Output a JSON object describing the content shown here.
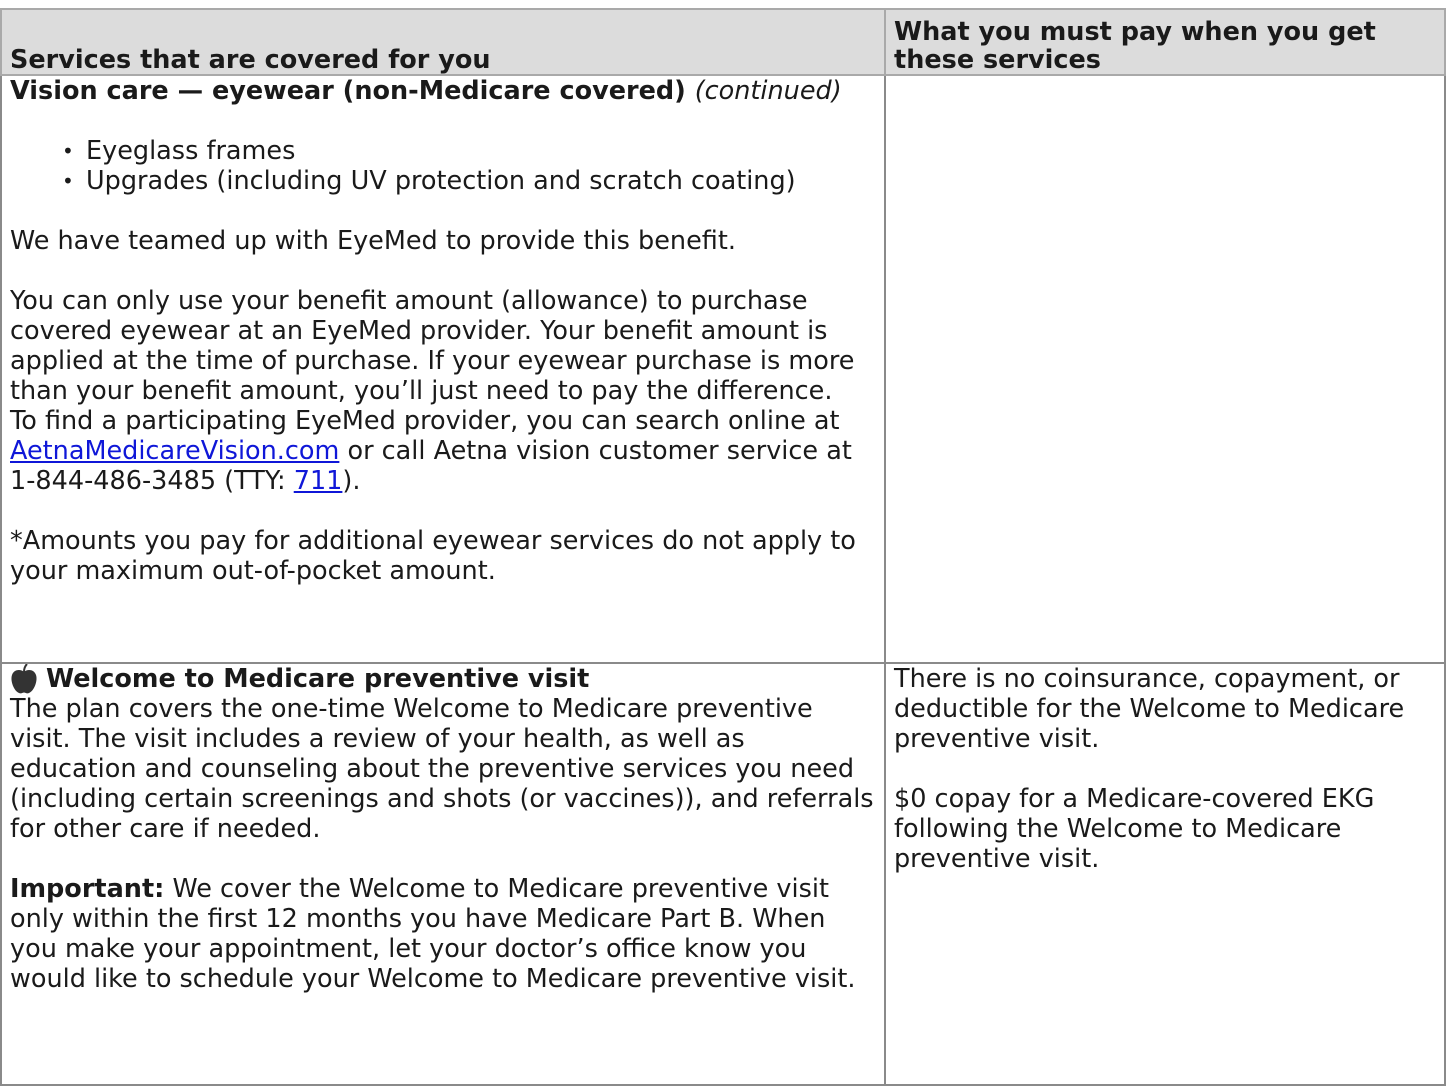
{
  "header": {
    "col1": "Services that are covered for you",
    "col2": "What you must pay when you get these services"
  },
  "vision": {
    "title": "Vision care — eyewear (non-Medicare covered)",
    "continued": "(continued)",
    "bullets": [
      "Eyeglass frames",
      "Upgrades (including UV protection and scratch coating)"
    ],
    "partner_text": "We have teamed up with EyeMed to provide this benefit.",
    "allowance_text": "You can only use your benefit amount (allowance) to purchase covered eyewear at an EyeMed provider. Your benefit amount is applied at the time of purchase. If your eyewear purchase is more than your benefit amount, you’ll just need to pay the difference.",
    "find_prefix": "To find a participating EyeMed provider, you can search online at",
    "find_link": "AetnaMedicareVision.com",
    "find_middle": "or call Aetna vision customer service at 1-844-486-3485 (TTY:",
    "tty_link": "711",
    "find_suffix": ").",
    "footnote": "*Amounts you pay for additional eyewear services do not apply to your maximum out-of-pocket amount."
  },
  "welcome": {
    "icon": "apple-icon",
    "title": "Welcome to Medicare preventive visit",
    "description": "The plan covers the one-time Welcome to Medicare preventive visit. The visit includes a review of your health, as well as education and counseling about the preventive services you need (including certain screenings and shots (or vaccines)), and referrals for other care if needed.",
    "important_label": "Important:",
    "important_text": "We cover the Welcome to Medicare preventive visit only within the first 12 months you have Medicare Part B. When you make your appointment, let your doctor’s office know you would like to schedule your Welcome to Medicare preventive visit.",
    "cost_1": "There is no coinsurance, copayment, or deductible for the Welcome to Medicare preventive visit.",
    "cost_2": "$0 copay for a Medicare-covered EKG following the Welcome to Medicare preventive visit."
  }
}
